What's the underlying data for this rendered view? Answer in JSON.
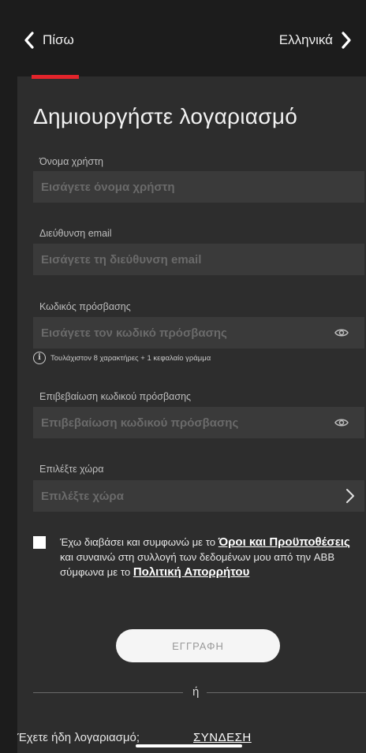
{
  "nav": {
    "back_label": "Πίσω",
    "language_label": "Ελληνικά"
  },
  "form": {
    "title": "Δημιουργήστε λογαριασμό",
    "username": {
      "label": "Όνομα χρήστη",
      "placeholder": "Εισάγετε όνομα χρήστη",
      "value": ""
    },
    "email": {
      "label": "Διεύθυνση email",
      "placeholder": "Εισάγετε τη διεύθυνση email",
      "value": ""
    },
    "password": {
      "label": "Κωδικός πρόσβασης",
      "placeholder": "Εισάγετε τον κωδικό πρόσβασης",
      "value": "",
      "hint": "Τουλάχιστον 8 χαρακτήρες + 1 κεφαλαίο γράμμα"
    },
    "confirm_password": {
      "label": "Επιβεβαίωση κωδικού πρόσβασης",
      "placeholder": "Επιβεβαίωση κωδικού πρόσβασης",
      "value": ""
    },
    "country": {
      "label": "Επιλέξτε χώρα",
      "placeholder": "Επιλέξτε χώρα",
      "value": ""
    }
  },
  "terms": {
    "text_1": "Έχω διαβάσει και συμφωνώ με το ",
    "terms_link": "Όροι και Προϋποθέσεις",
    "text_2": " και συναινώ στη συλλογή των δεδομένων μου από την ABB σύμφωνα με το ",
    "privacy_link": "Πολιτική Απορρήτου",
    "checked": false
  },
  "actions": {
    "register_label": "ΕΓΓΡΑΦΗ",
    "or_label": "ή",
    "have_account_label": "Έχετε ήδη λογαριασμό;",
    "login_label": "ΣΥΝΔΕΣΗ"
  },
  "colors": {
    "background": "#1c1c1c",
    "panel": "#2d2d2d",
    "field": "#3a3a3a",
    "accent": "#e3242b"
  }
}
